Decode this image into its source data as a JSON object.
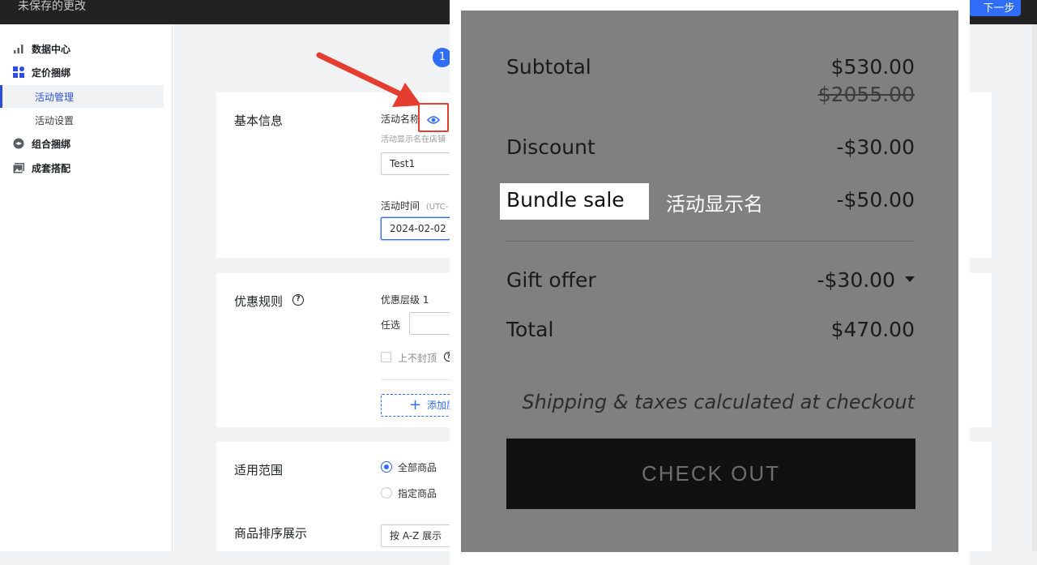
{
  "topbar": {
    "unsaved_text": "未保存的更改",
    "next_label": "下一步"
  },
  "sidebar": {
    "items": [
      {
        "label": "数据中心",
        "icon": "bar-chart-icon"
      },
      {
        "label": "定价捆绑",
        "icon": "grid-icon"
      },
      {
        "label": "活动管理",
        "sub": true,
        "active": true
      },
      {
        "label": "活动设置",
        "sub": true
      },
      {
        "label": "组合捆绑",
        "icon": "layers-icon"
      },
      {
        "label": "成套搭配",
        "icon": "image-icon"
      }
    ]
  },
  "step": {
    "number": "1"
  },
  "basic_info": {
    "title": "基本信息",
    "name_label": "活动名称",
    "name_hint": "活动显示名在店铺",
    "name_value": "Test1",
    "time_label": "活动时间",
    "time_hint": "(UTC-",
    "time_value": "2024-02-02"
  },
  "discount_rules": {
    "title": "优惠规则",
    "help_icon": "question-icon",
    "tier_label": "优惠层级 1",
    "optional_label": "任选",
    "no_cap_label": "上不封顶",
    "add_label": "添加层"
  },
  "scope": {
    "title": "适用范围",
    "all_products": "全部商品",
    "specified_products": "指定商品"
  },
  "sort": {
    "title": "商品排序展示",
    "value": "按 A-Z 展示"
  },
  "preview": {
    "subtotal_label": "Subtotal",
    "subtotal_value": "$530.00",
    "original_value": "$2055.00",
    "discount_label": "Discount",
    "discount_value": "-$30.00",
    "bundle_label": "Bundle sale",
    "bundle_display_name": "活动显示名",
    "bundle_value": "-$50.00",
    "gift_label": "Gift offer",
    "gift_value": "-$30.00",
    "total_label": "Total",
    "total_value": "$470.00",
    "shipping_note": "Shipping & taxes calculated at checkout",
    "checkout_label": "CHECK OUT"
  },
  "colors": {
    "accent": "#2f6df6",
    "annotation": "#e53e31",
    "preview_bg": "#808080"
  }
}
